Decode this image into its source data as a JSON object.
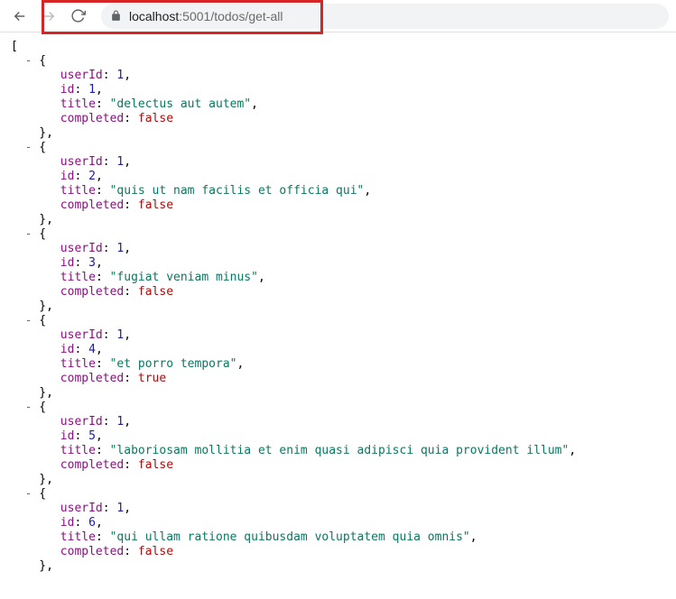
{
  "browser": {
    "url_host": "localhost",
    "url_port": ":5001",
    "url_path": "/todos/get-all"
  },
  "json_labels": {
    "userId": "userId",
    "id": "id",
    "title": "title",
    "completed": "completed"
  },
  "todos": [
    {
      "userId": 1,
      "id": 1,
      "title": "\"delectus aut autem\"",
      "completed": "false"
    },
    {
      "userId": 1,
      "id": 2,
      "title": "\"quis ut nam facilis et officia qui\"",
      "completed": "false"
    },
    {
      "userId": 1,
      "id": 3,
      "title": "\"fugiat veniam minus\"",
      "completed": "false"
    },
    {
      "userId": 1,
      "id": 4,
      "title": "\"et porro tempora\"",
      "completed": "true"
    },
    {
      "userId": 1,
      "id": 5,
      "title": "\"laboriosam mollitia et enim quasi adipisci quia provident illum\"",
      "completed": "false"
    },
    {
      "userId": 1,
      "id": 6,
      "title": "\"qui ullam ratione quibusdam voluptatem quia omnis\"",
      "completed": "false"
    }
  ]
}
